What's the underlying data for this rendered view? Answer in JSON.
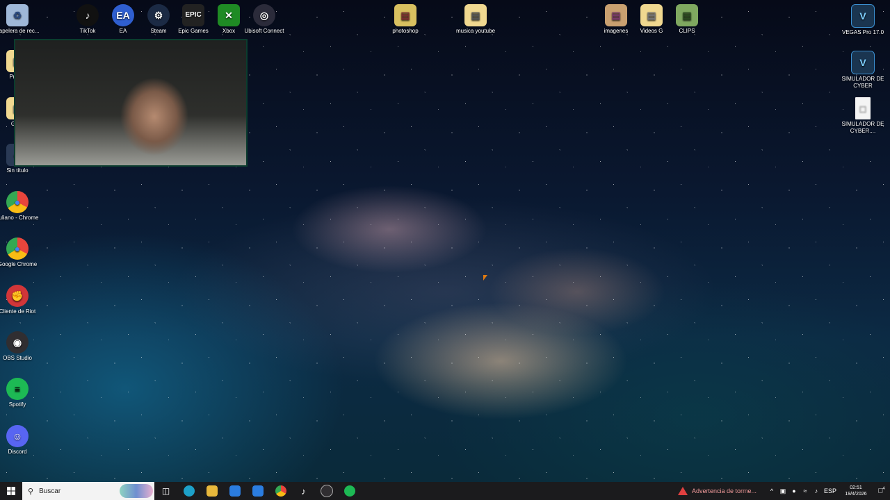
{
  "desktop_icons_top": [
    {
      "label": "Papelera de rec...",
      "glyph": "♻",
      "color": "#9fb8d8"
    },
    {
      "label": "TikTok",
      "glyph": "♪",
      "color": "#111111"
    },
    {
      "label": "EA",
      "glyph": "EA",
      "color": "#2f5fd0"
    },
    {
      "label": "Steam",
      "glyph": "⚙",
      "color": "#1b2a44"
    },
    {
      "label": "Epic Games",
      "glyph": "EPIC",
      "color": "#222222"
    },
    {
      "label": "Xbox",
      "glyph": "✕",
      "color": "#1f8b24"
    },
    {
      "label": "Ubisoft Connect",
      "glyph": "◎",
      "color": "#2b2b3a"
    },
    {
      "label": "photoshop",
      "glyph": "▤",
      "color": "#d8c060"
    },
    {
      "label": "musica youtube",
      "glyph": "▤",
      "color": "#f0d890"
    },
    {
      "label": "imagenes",
      "glyph": "▤",
      "color": "#c9a070"
    },
    {
      "label": "Videos G",
      "glyph": "▤",
      "color": "#f0d890"
    },
    {
      "label": "CLIPS",
      "glyph": "▤",
      "color": "#7fa860"
    }
  ],
  "desktop_icons_left": [
    {
      "label": "Proc...",
      "glyph": "▤",
      "color": "#f0d890"
    },
    {
      "label": "GA...",
      "glyph": "▤",
      "color": "#f0d890"
    },
    {
      "label": "Sin título",
      "glyph": "✐",
      "color": "#2a3a55"
    },
    {
      "label": "Juliano - Chrome",
      "glyph": "●",
      "color": "#e8453c"
    },
    {
      "label": "Google Chrome",
      "glyph": "●",
      "color": "#e8453c"
    },
    {
      "label": "Cliente de Riot",
      "glyph": "✊",
      "color": "#d13639"
    },
    {
      "label": "OBS Studio",
      "glyph": "◉",
      "color": "#302e31"
    },
    {
      "label": "Spotify",
      "glyph": "≡",
      "color": "#1db954"
    },
    {
      "label": "Discord",
      "glyph": "☺",
      "color": "#5865f2"
    }
  ],
  "desktop_icons_right": [
    {
      "label": "VEGAS Pro 17.0",
      "glyph": "V",
      "color": "#1a3550"
    },
    {
      "label": "SIMULADOR DE CYBER",
      "glyph": "V",
      "color": "#1a3550"
    },
    {
      "label": "SIMULADOR DE CYBER....",
      "glyph": "□",
      "color": "#f4f4f4"
    }
  ],
  "taskbar": {
    "start_icon": "windows-icon",
    "search_placeholder": "Buscar",
    "apps": [
      {
        "name": "task-view",
        "glyph": "◫",
        "color": "#1b1b1d"
      },
      {
        "name": "edge",
        "glyph": "e",
        "color": "#1da1c9"
      },
      {
        "name": "file-explorer",
        "glyph": "▤",
        "color": "#e8b83c"
      },
      {
        "name": "store",
        "glyph": "▦",
        "color": "#2b7de0"
      },
      {
        "name": "mail",
        "glyph": "✉",
        "color": "#2b7de0"
      },
      {
        "name": "chrome",
        "glyph": "●",
        "color": "#e8453c"
      },
      {
        "name": "tiktok",
        "glyph": "♪",
        "color": "#111111"
      },
      {
        "name": "obs",
        "glyph": "◉",
        "color": "#302e31"
      },
      {
        "name": "spotify",
        "glyph": "≡",
        "color": "#1db954"
      }
    ],
    "weather_text": "Advertencia de torme...",
    "language": "ESP",
    "time": "02:51",
    "date": "19/4/2026",
    "notifications": "4"
  }
}
